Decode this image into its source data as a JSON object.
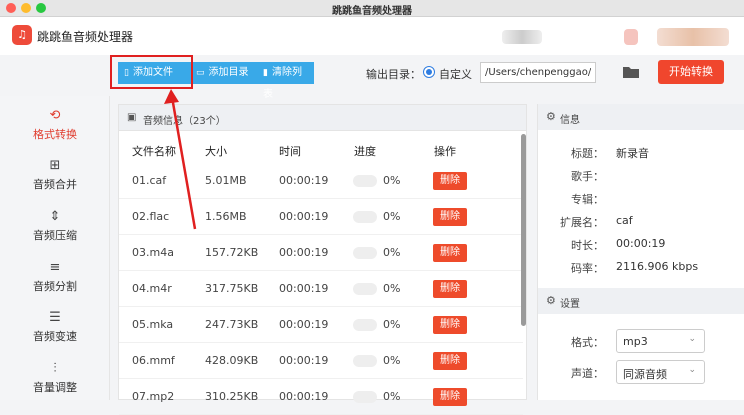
{
  "window_title": "跳跳鱼音频处理器",
  "app_name": "跳跳鱼音频处理器",
  "app_logo_glyph": "♫",
  "sidebar": {
    "items": [
      {
        "label": "格式转换",
        "icon": "refresh-cycle-icon",
        "glyph": "⟲",
        "active": true
      },
      {
        "label": "音频合并",
        "icon": "merge-icon",
        "glyph": "⊞"
      },
      {
        "label": "音频压缩",
        "icon": "compress-icon",
        "glyph": "⇕"
      },
      {
        "label": "音频分割",
        "icon": "split-icon",
        "glyph": "≡"
      },
      {
        "label": "音频变速",
        "icon": "speed-sliders-icon",
        "glyph": "☰"
      },
      {
        "label": "音量调整",
        "icon": "volume-sliders-icon",
        "glyph": "⫶"
      }
    ]
  },
  "toolbar": {
    "add_file": "添加文件",
    "add_folder": "添加目录",
    "clear_list": "清除列表",
    "output_label": "输出目录：",
    "custom_label": "自定义",
    "path_value": "/Users/chenpenggao/C",
    "start_button": "开始转换"
  },
  "file_panel": {
    "title": "音频信息（23个）",
    "columns": [
      "文件名称",
      "大小",
      "时间",
      "进度",
      "操作"
    ],
    "rows": [
      {
        "name": "01.caf",
        "size": "5.01MB",
        "time": "00:00:19",
        "progress": "0%",
        "action": "删除"
      },
      {
        "name": "02.flac",
        "size": "1.56MB",
        "time": "00:00:19",
        "progress": "0%",
        "action": "删除"
      },
      {
        "name": "03.m4a",
        "size": "157.72KB",
        "time": "00:00:19",
        "progress": "0%",
        "action": "删除"
      },
      {
        "name": "04.m4r",
        "size": "317.75KB",
        "time": "00:00:19",
        "progress": "0%",
        "action": "删除"
      },
      {
        "name": "05.mka",
        "size": "247.73KB",
        "time": "00:00:19",
        "progress": "0%",
        "action": "删除"
      },
      {
        "name": "06.mmf",
        "size": "428.09KB",
        "time": "00:00:19",
        "progress": "0%",
        "action": "删除"
      },
      {
        "name": "07.mp2",
        "size": "310.25KB",
        "time": "00:00:19",
        "progress": "0%",
        "action": "删除"
      }
    ]
  },
  "info": {
    "header": "信息",
    "fields": [
      {
        "key": "标题：",
        "value": "新录音"
      },
      {
        "key": "歌手：",
        "value": ""
      },
      {
        "key": "专辑：",
        "value": ""
      },
      {
        "key": "扩展名：",
        "value": "caf"
      },
      {
        "key": "时长：",
        "value": "00:00:19"
      },
      {
        "key": "码率：",
        "value": "2116.906 kbps"
      }
    ]
  },
  "settings": {
    "header": "设置",
    "format_label": "格式：",
    "format_value": "mp3",
    "channel_label": "声道：",
    "channel_value": "同源音频"
  },
  "colors": {
    "accent_red": "#f0462d",
    "toolbar_blue": "#39a9e8",
    "annotation_red": "#e02020"
  }
}
